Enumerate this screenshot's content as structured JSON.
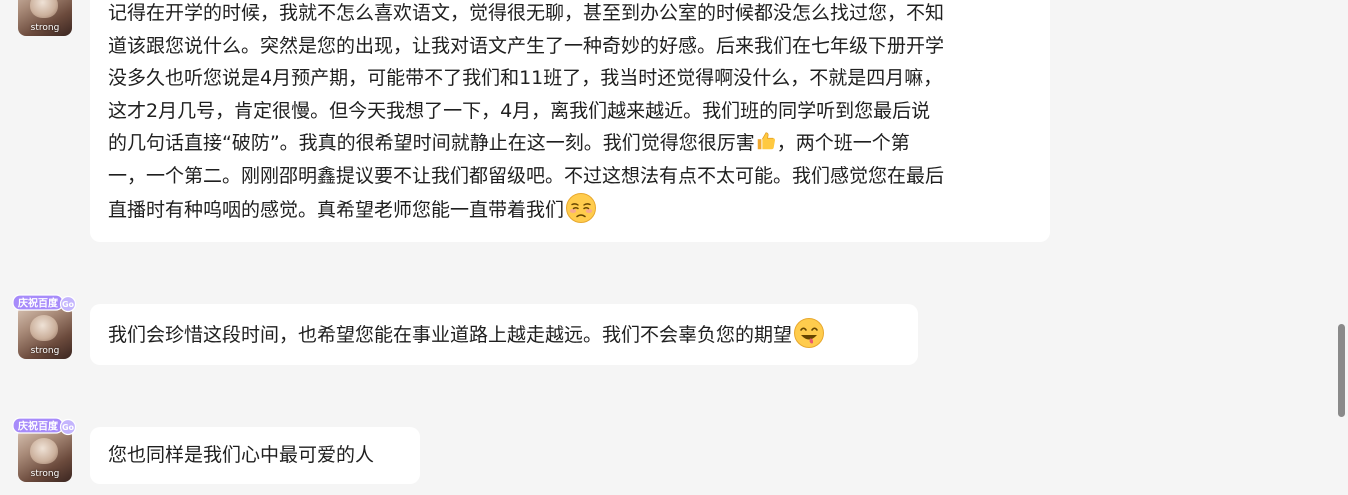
{
  "messages": [
    {
      "avatar_caption": "strong",
      "text_parts": [
        "记得在开学的时候，我就不怎么喜欢语文，觉得很无聊，甚至到办公室的时候都没怎么找过您，不知",
        "道该跟您说什么。突然是您的出现，让我对语文产生了一种奇妙的好感。后来我们在七年级下册开学",
        "没多久也听您说是4月预产期，可能带不了我们和11班了，我当时还觉得啊没什么，不就是四月嘛，",
        "这才2月几号，肯定很慢。但今天我想了一下，4月，离我们越来越近。我们班的同学听到您最后说",
        "的几句话直接“破防”。我真的很希望时间就静止在这一刻。我们觉得您很厉害",
        "，两个班一个第",
        "一，一个第二。刚刚邵明鑫提议要不让我们都留级吧。不过这想法有点不太可能。我们感觉您在最后",
        "直播时有种呜咽的感觉。真希望老师您能一直带着我们"
      ],
      "emojis": [
        "thumbs-up-emoji",
        "pleading-face-emoji"
      ]
    },
    {
      "avatar_caption": "strong",
      "badge_text": "庆祝百度",
      "text": "我们会珍惜这段时间，也希望您能在事业道路上越走越远。我们不会辜负您的期望",
      "emoji": "face-savoring-emoji"
    },
    {
      "avatar_caption": "strong",
      "badge_text": "庆祝百度",
      "text": "您也同样是我们心中最可爱的人"
    }
  ],
  "colors": {
    "background": "#f5f5f5",
    "bubble": "#ffffff",
    "text": "#1f1f1f",
    "badge": "#8b5cf6",
    "scrollbar_thumb": "#8a8a8a"
  }
}
